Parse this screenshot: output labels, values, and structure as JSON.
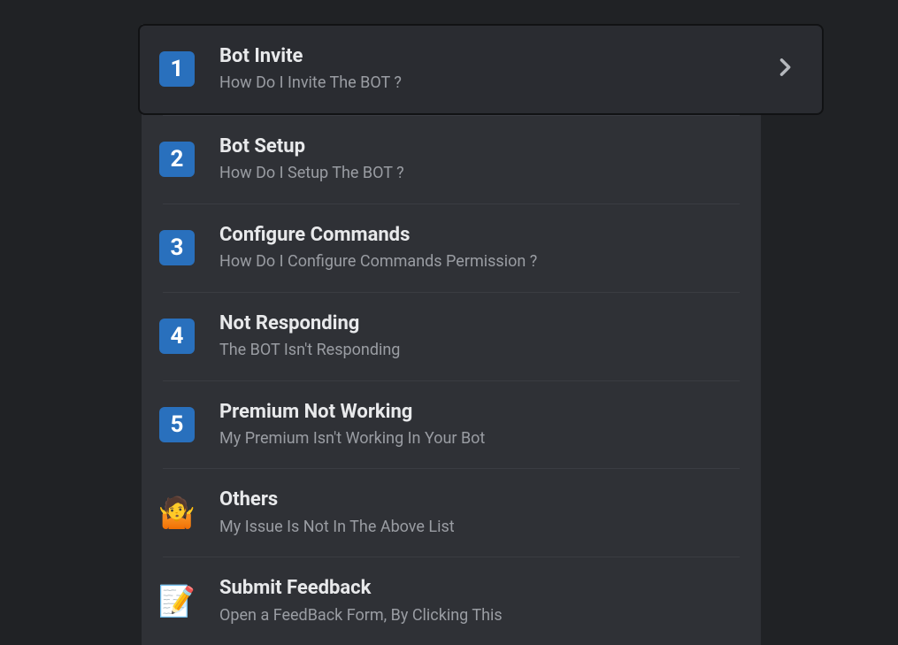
{
  "menu": {
    "items": [
      {
        "badge": "1",
        "title": "Bot Invite",
        "subtitle": "How Do I Invite The BOT ?"
      },
      {
        "badge": "2",
        "title": "Bot Setup",
        "subtitle": "How Do I Setup The BOT ?"
      },
      {
        "badge": "3",
        "title": "Configure Commands",
        "subtitle": "How Do I Configure Commands Permission ?"
      },
      {
        "badge": "4",
        "title": "Not Responding",
        "subtitle": "The BOT Isn't Responding"
      },
      {
        "badge": "5",
        "title": "Premium Not Working",
        "subtitle": "My Premium Isn't Working In Your Bot"
      },
      {
        "emoji": "🤷",
        "title": "Others",
        "subtitle": "My Issue Is Not In The Above List"
      },
      {
        "emoji": "📝",
        "title": "Submit Feedback",
        "subtitle": "Open a FeedBack Form, By Clicking This"
      }
    ]
  }
}
